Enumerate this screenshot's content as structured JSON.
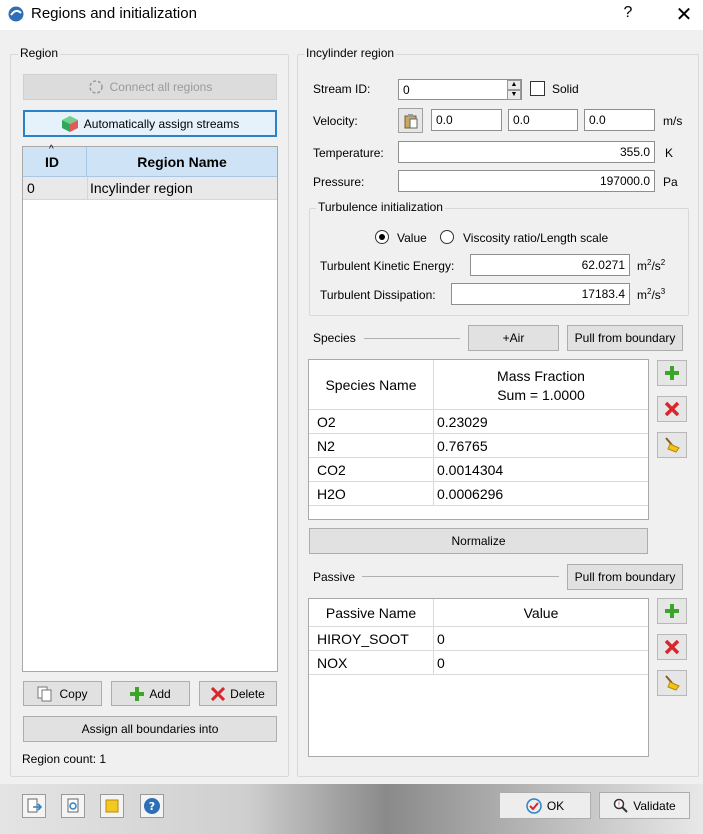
{
  "window": {
    "title": "Regions and initialization",
    "help": "?",
    "close": "✕"
  },
  "region_panel": {
    "title": "Region",
    "connect_all_label": "Connect all regions",
    "auto_assign_label": "Automatically assign streams",
    "table": {
      "col_id": "ID",
      "col_name": "Region Name",
      "rows": [
        {
          "id": "0",
          "name": "Incylinder region"
        }
      ]
    },
    "copy_label": "Copy",
    "add_label": "Add",
    "delete_label": "Delete",
    "assign_boundaries_label": "Assign all boundaries into",
    "region_count": "Region count: 1"
  },
  "incylinder": {
    "title": "Incylinder region",
    "stream_id_label": "Stream ID:",
    "stream_id_value": "0",
    "solid_label": "Solid",
    "velocity_label": "Velocity:",
    "velocity_x": "0.0",
    "velocity_y": "0.0",
    "velocity_z": "0.0",
    "velocity_unit": "m/s",
    "temperature_label": "Temperature:",
    "temperature_value": "355.0",
    "temperature_unit": "K",
    "pressure_label": "Pressure:",
    "pressure_value": "197000.0",
    "pressure_unit": "Pa",
    "turbulence": {
      "title": "Turbulence initialization",
      "option_value": "Value",
      "option_ratio": "Viscosity ratio/Length scale",
      "tke_label": "Turbulent Kinetic Energy:",
      "tke_value": "62.0271",
      "tke_unit_base": "m",
      "tke_unit_exp1": "2",
      "tke_unit_mid": "/s",
      "tke_unit_exp2": "2",
      "diss_label": "Turbulent Dissipation:",
      "diss_value": "17183.4",
      "diss_unit_base": "m",
      "diss_unit_exp1": "2",
      "diss_unit_mid": "/s",
      "diss_unit_exp2": "3"
    },
    "species": {
      "title": "Species",
      "air_label": "+Air",
      "pull_label": "Pull from boundary",
      "col_name": "Species Name",
      "col_fraction": "Mass Fraction",
      "col_sum": "Sum = 1.0000",
      "rows": [
        {
          "name": "O2",
          "value": "0.23029"
        },
        {
          "name": "N2",
          "value": "0.76765"
        },
        {
          "name": "CO2",
          "value": "0.0014304"
        },
        {
          "name": "H2O",
          "value": "0.0006296"
        }
      ],
      "normalize_label": "Normalize"
    },
    "passive": {
      "title": "Passive",
      "pull_label": "Pull from boundary",
      "col_name": "Passive Name",
      "col_value": "Value",
      "rows": [
        {
          "name": "HIROY_SOOT",
          "value": "0"
        },
        {
          "name": "NOX",
          "value": "0"
        }
      ]
    }
  },
  "footer": {
    "ok_label": "OK",
    "validate_label": "Validate"
  },
  "colors": {
    "accent": "#2a82c8",
    "header_blue": "#cfe3f7",
    "add_green": "#3aa528",
    "delete_red": "#d9262b"
  }
}
